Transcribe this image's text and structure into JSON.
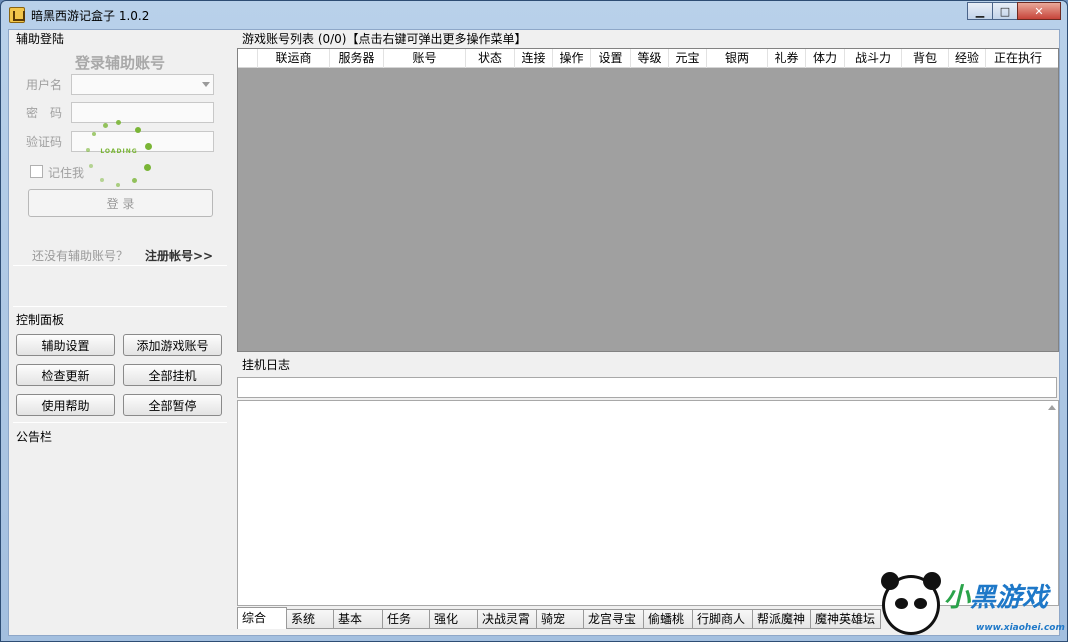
{
  "window": {
    "title": "暗黑西游记盒子 1.0.2",
    "minimize": "▁",
    "maximize": "□",
    "close": "✕"
  },
  "login": {
    "group_label": "辅助登陆",
    "title": "登录辅助账号",
    "username_label": "用户名",
    "password_label": "密　码",
    "captcha_label": "验证码",
    "remember_label": "记住我",
    "login_button": "登 录",
    "no_account_text": "还没有辅助账号？",
    "register_link": "注册帐号>>",
    "loading_text": "LOADING"
  },
  "control_panel": {
    "label": "控制面板",
    "buttons": [
      "辅助设置",
      "添加游戏账号",
      "检查更新",
      "全部挂机",
      "使用帮助",
      "全部暂停"
    ]
  },
  "notice": {
    "label": "公告栏"
  },
  "account_list": {
    "label": "游戏账号列表 (0/0)【点击右键可弹出更多操作菜单】",
    "columns": [
      "",
      "联运商",
      "服务器",
      "账号",
      "状态",
      "连接",
      "操作",
      "设置",
      "等级",
      "元宝",
      "银两",
      "礼券",
      "体力",
      "战斗力",
      "背包",
      "经验",
      "正在执行"
    ]
  },
  "log": {
    "label": "挂机日志",
    "tabs": [
      "综合",
      "系统",
      "基本",
      "任务",
      "强化",
      "决战灵霄",
      "骑宠",
      "龙宫寻宝",
      "偷蟠桃",
      "行脚商人",
      "帮派魔神",
      "魔神英雄坛"
    ]
  },
  "watermark": {
    "text_a": "小",
    "text_b": "黑游戏",
    "url": "www.xiaohei.com"
  },
  "colors": {
    "grid_bg": "#a0a0a0",
    "spinner": "#7ab536",
    "title_bar": "#b9d1ea"
  }
}
